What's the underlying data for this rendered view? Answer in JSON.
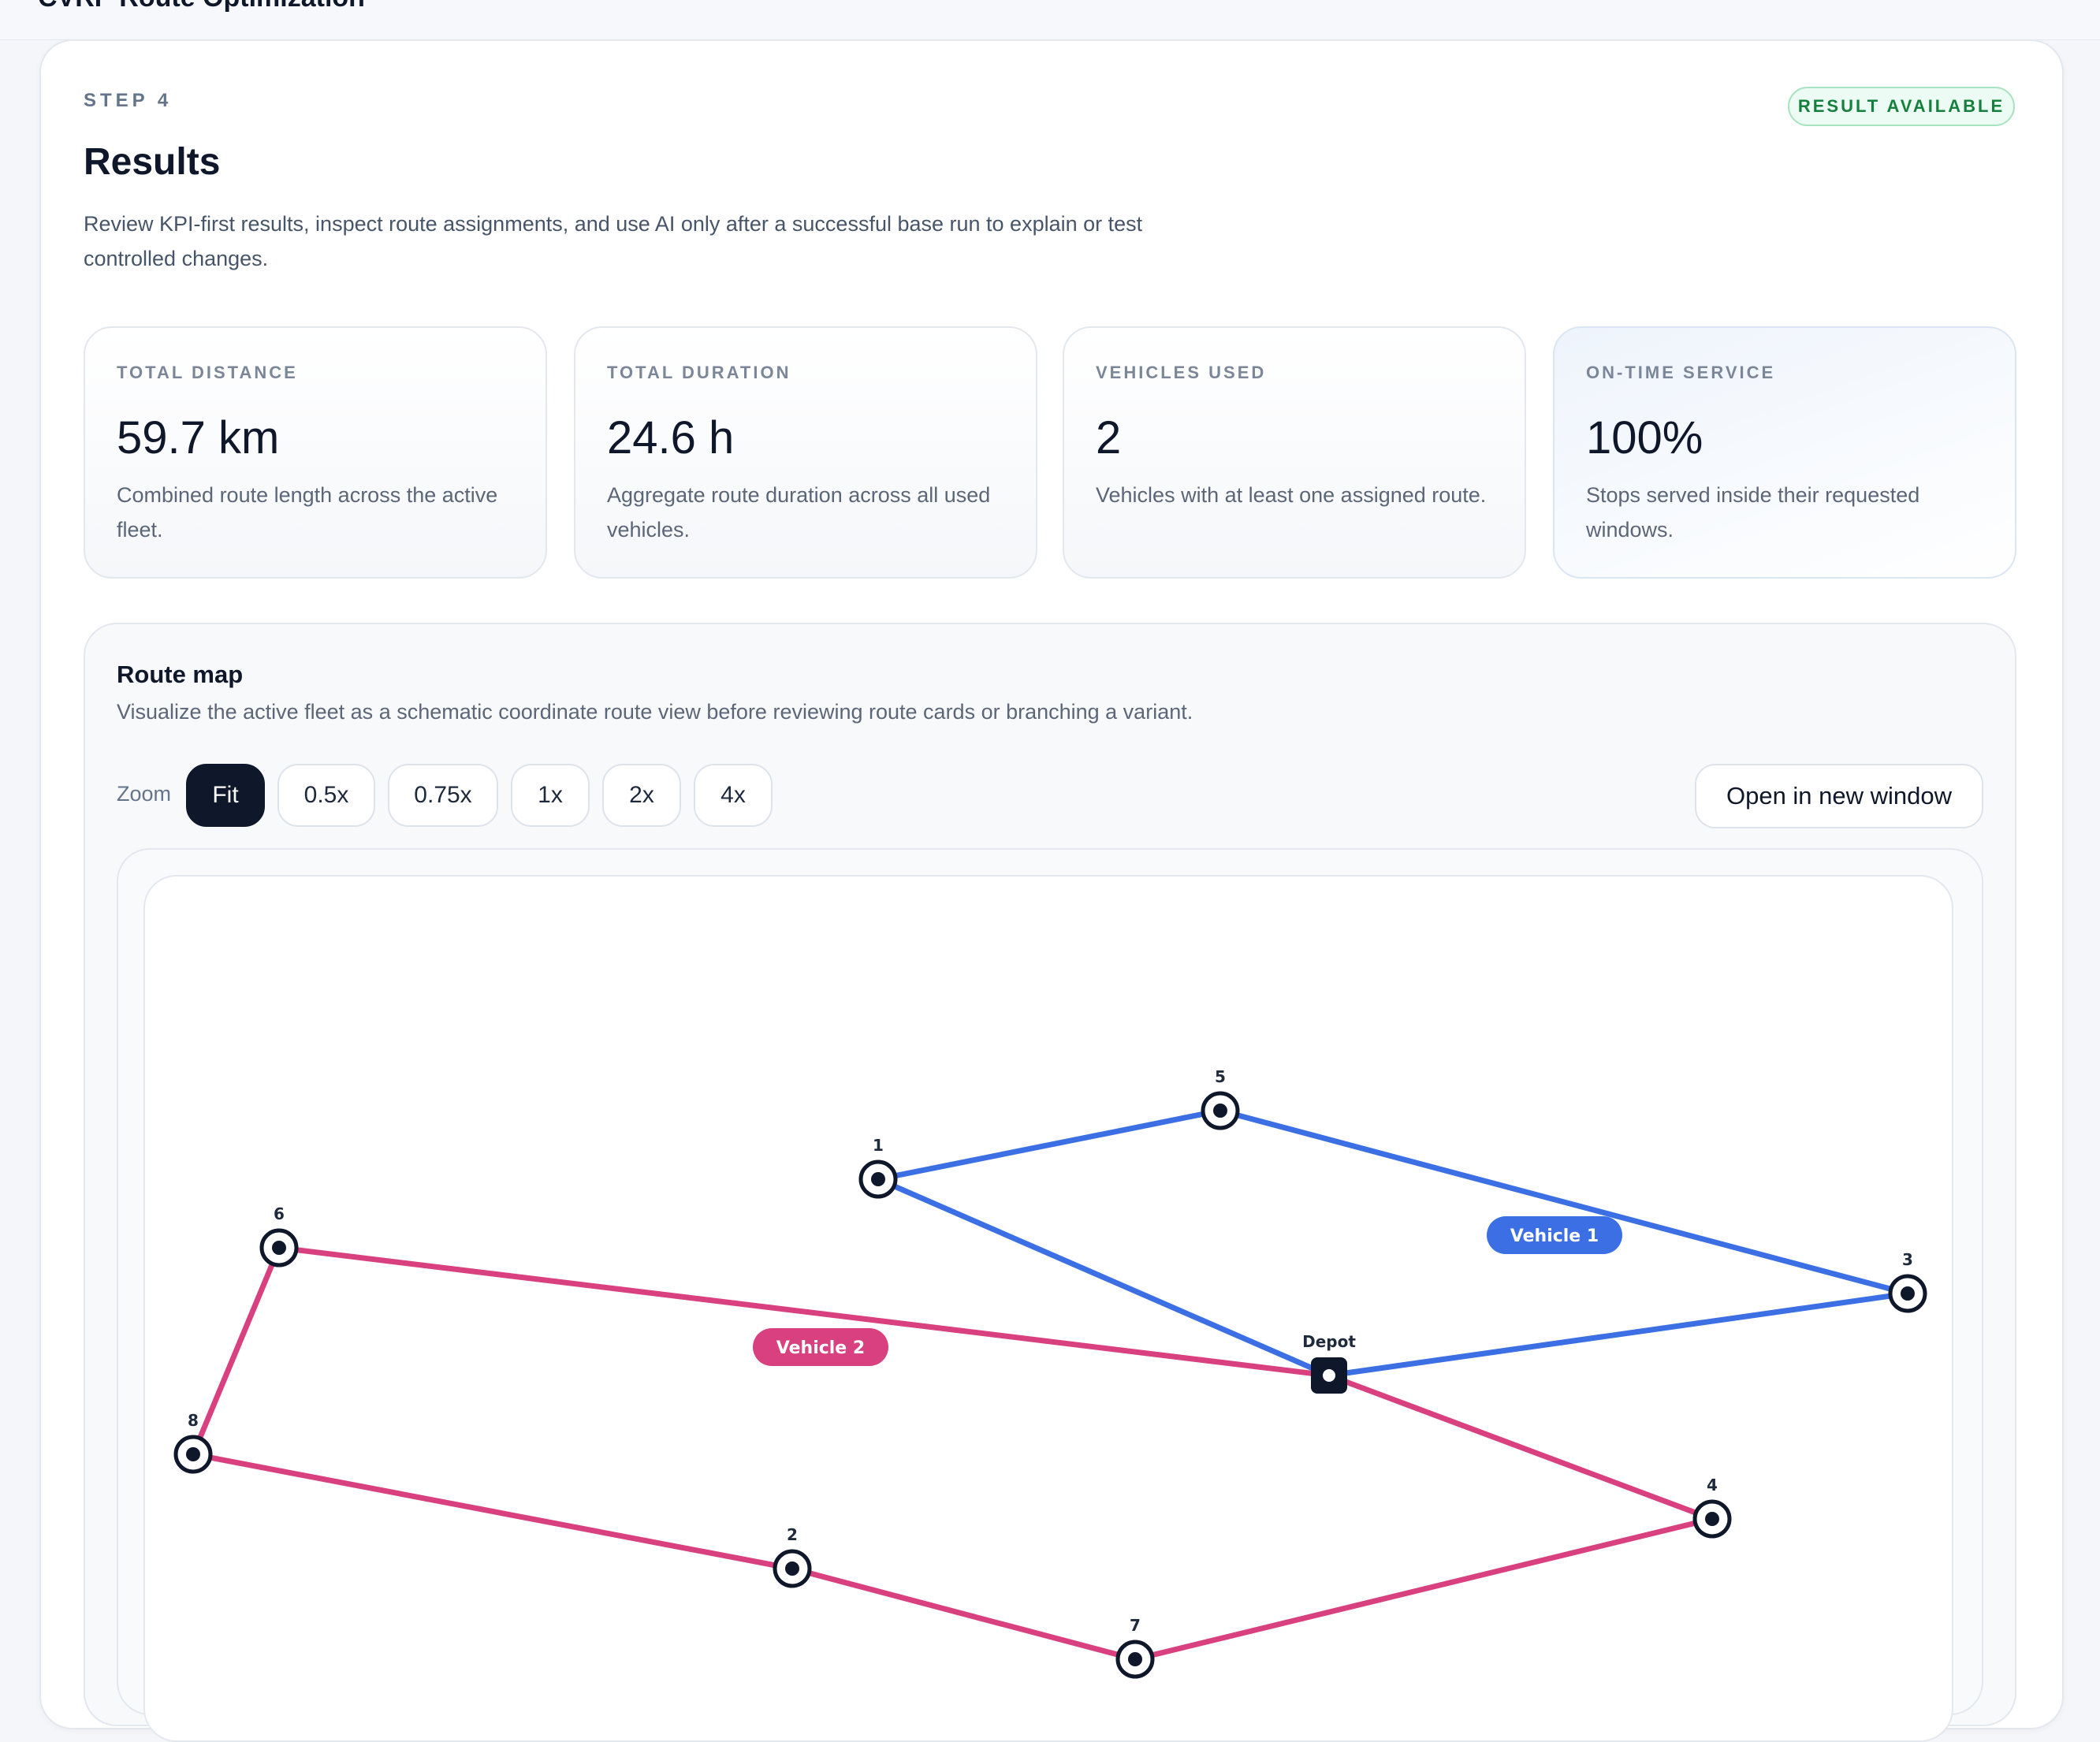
{
  "app": {
    "title": "CVRP Route Optimization"
  },
  "step": {
    "label": "STEP 4",
    "badge": "RESULT AVAILABLE",
    "title": "Results",
    "description": "Review KPI-first results, inspect route assignments, and use AI only after a successful base run to explain or test controlled changes."
  },
  "kpis": [
    {
      "label": "TOTAL DISTANCE",
      "value": "59.7 km",
      "description": "Combined route length across the active fleet."
    },
    {
      "label": "TOTAL DURATION",
      "value": "24.6 h",
      "description": "Aggregate route duration across all used vehicles."
    },
    {
      "label": "VEHICLES USED",
      "value": "2",
      "description": "Vehicles with at least one assigned route."
    },
    {
      "label": "ON-TIME SERVICE",
      "value": "100%",
      "description": "Stops served inside their requested windows."
    }
  ],
  "route_map": {
    "title": "Route map",
    "description": "Visualize the active fleet as a schematic coordinate route view before reviewing route cards or branching a variant.",
    "zoom_label": "Zoom",
    "zoom_options": [
      "Fit",
      "0.5x",
      "0.75x",
      "1x",
      "2x",
      "4x"
    ],
    "zoom_selected": "Fit",
    "open_button": "Open in new window",
    "depot_label": "Depot",
    "stops": [
      "1",
      "2",
      "3",
      "4",
      "5",
      "6",
      "7",
      "8"
    ],
    "routes": [
      {
        "name": "Vehicle 1",
        "color": "#3b6fe3",
        "sequence": [
          "Depot",
          "1",
          "5",
          "3",
          "Depot"
        ]
      },
      {
        "name": "Vehicle 2",
        "color": "#d9407f",
        "sequence": [
          "Depot",
          "6",
          "8",
          "2",
          "7",
          "4",
          "Depot"
        ]
      }
    ]
  },
  "colors": {
    "accent_dark": "#0f172a",
    "success": "#15803d",
    "vehicle_1": "#3b6fe3",
    "vehicle_2": "#d9407f"
  }
}
